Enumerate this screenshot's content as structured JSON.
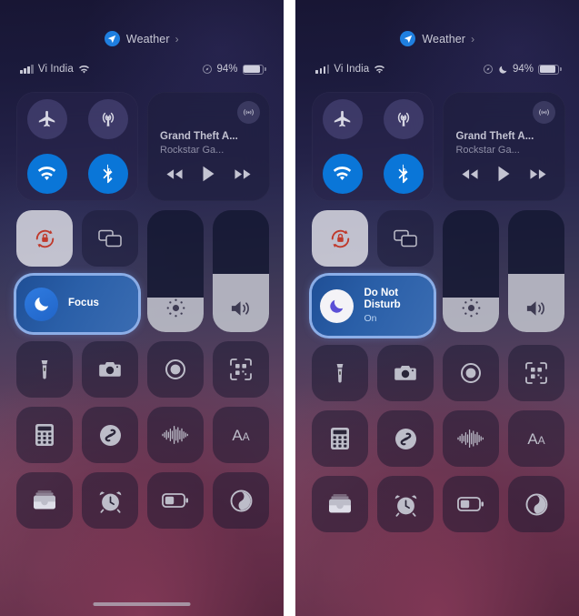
{
  "panels": [
    {
      "id": "left",
      "weather": {
        "label": "Weather",
        "chevron": "›",
        "icon": "location-arrow-icon"
      },
      "status": {
        "carrier": "Vi India",
        "signal_bars": 3,
        "wifi": "wifi-icon",
        "location": "location-services-icon",
        "dnd_indicator": false,
        "battery_percent": "94%",
        "battery_level": 94
      },
      "connectivity": [
        {
          "name": "airplane-mode",
          "icon": "airplane-icon",
          "state": "off"
        },
        {
          "name": "cellular-data",
          "icon": "cellular-icon",
          "state": "off"
        },
        {
          "name": "wifi",
          "icon": "wifi-icon",
          "state": "on"
        },
        {
          "name": "bluetooth",
          "icon": "bluetooth-icon",
          "state": "on"
        }
      ],
      "media": {
        "title": "Grand Theft A...",
        "artist": "Rockstar Ga...",
        "airplay_icon": "airplay-audio-icon",
        "controls": [
          "rewind-icon",
          "play-icon",
          "fast-forward-icon"
        ]
      },
      "tiles": [
        {
          "name": "rotation-lock",
          "icon": "rotation-lock-icon",
          "state": "on"
        },
        {
          "name": "screen-mirroring",
          "icon": "screen-mirroring-icon",
          "state": "off"
        }
      ],
      "focus": {
        "name": "Focus",
        "subtitle": "",
        "icon": "moon-icon",
        "active": false,
        "selected": true
      },
      "sliders": [
        {
          "name": "brightness",
          "icon": "brightness-icon",
          "level": 28
        },
        {
          "name": "volume",
          "icon": "volume-icon",
          "level": 48
        }
      ],
      "grid": [
        {
          "name": "flashlight",
          "icon": "flashlight-icon"
        },
        {
          "name": "camera",
          "icon": "camera-icon"
        },
        {
          "name": "screen-record",
          "icon": "screen-record-icon"
        },
        {
          "name": "code-scanner",
          "icon": "qr-scanner-icon"
        },
        {
          "name": "calculator",
          "icon": "calculator-icon"
        },
        {
          "name": "shazam",
          "icon": "shazam-icon"
        },
        {
          "name": "voice-memos",
          "icon": "voice-memos-icon"
        },
        {
          "name": "text-size",
          "icon": "text-size-icon"
        },
        {
          "name": "wallet",
          "icon": "wallet-icon"
        },
        {
          "name": "alarm",
          "icon": "alarm-clock-icon"
        },
        {
          "name": "low-power-mode",
          "icon": "battery-icon"
        },
        {
          "name": "dark-mode",
          "icon": "dark-mode-icon"
        }
      ]
    },
    {
      "id": "right",
      "weather": {
        "label": "Weather",
        "chevron": "›",
        "icon": "location-arrow-icon"
      },
      "status": {
        "carrier": "Vi India",
        "signal_bars": 3,
        "wifi": "wifi-icon",
        "location": "location-services-icon",
        "dnd_indicator": true,
        "battery_percent": "94%",
        "battery_level": 94
      },
      "connectivity": [
        {
          "name": "airplane-mode",
          "icon": "airplane-icon",
          "state": "off"
        },
        {
          "name": "cellular-data",
          "icon": "cellular-icon",
          "state": "off"
        },
        {
          "name": "wifi",
          "icon": "wifi-icon",
          "state": "on"
        },
        {
          "name": "bluetooth",
          "icon": "bluetooth-icon",
          "state": "on"
        }
      ],
      "media": {
        "title": "Grand Theft A...",
        "artist": "Rockstar Ga...",
        "airplay_icon": "airplay-audio-icon",
        "controls": [
          "rewind-icon",
          "play-icon",
          "fast-forward-icon"
        ]
      },
      "tiles": [
        {
          "name": "rotation-lock",
          "icon": "rotation-lock-icon",
          "state": "on"
        },
        {
          "name": "screen-mirroring",
          "icon": "screen-mirroring-icon",
          "state": "off"
        }
      ],
      "focus": {
        "name": "Do Not Disturb",
        "subtitle": "On",
        "icon": "moon-icon",
        "active": true,
        "selected": true
      },
      "sliders": [
        {
          "name": "brightness",
          "icon": "brightness-icon",
          "level": 28
        },
        {
          "name": "volume",
          "icon": "volume-icon",
          "level": 48
        }
      ],
      "grid": [
        {
          "name": "flashlight",
          "icon": "flashlight-icon"
        },
        {
          "name": "camera",
          "icon": "camera-icon"
        },
        {
          "name": "screen-record",
          "icon": "screen-record-icon"
        },
        {
          "name": "code-scanner",
          "icon": "qr-scanner-icon"
        },
        {
          "name": "calculator",
          "icon": "calculator-icon"
        },
        {
          "name": "shazam",
          "icon": "shazam-icon"
        },
        {
          "name": "voice-memos",
          "icon": "voice-memos-icon"
        },
        {
          "name": "text-size",
          "icon": "text-size-icon"
        },
        {
          "name": "wallet",
          "icon": "wallet-icon"
        },
        {
          "name": "alarm",
          "icon": "alarm-clock-icon"
        },
        {
          "name": "low-power-mode",
          "icon": "battery-icon"
        },
        {
          "name": "dark-mode",
          "icon": "dark-mode-icon"
        }
      ]
    }
  ],
  "colors": {
    "accent_blue": "#0a76d8",
    "focus_ring": "#96beFA",
    "active_tile": "#e0e0e8",
    "rotation_lock_red": "#c0392b",
    "text_primary": "#ffffff",
    "text_secondary": "#8e8ea6"
  }
}
